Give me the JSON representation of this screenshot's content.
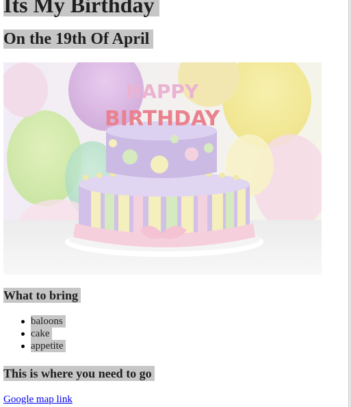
{
  "page": {
    "title": "Its My Birthday",
    "subtitle": "On the 19th Of April"
  },
  "photo": {
    "cake_text_top": "HAPPY",
    "cake_text_bottom": "BIRTHDAY"
  },
  "bring": {
    "heading": "What to bring",
    "items": [
      "baloons",
      "cake",
      "appetite"
    ]
  },
  "location": {
    "heading": "This is where you need to go",
    "link_text": "Google map link"
  }
}
